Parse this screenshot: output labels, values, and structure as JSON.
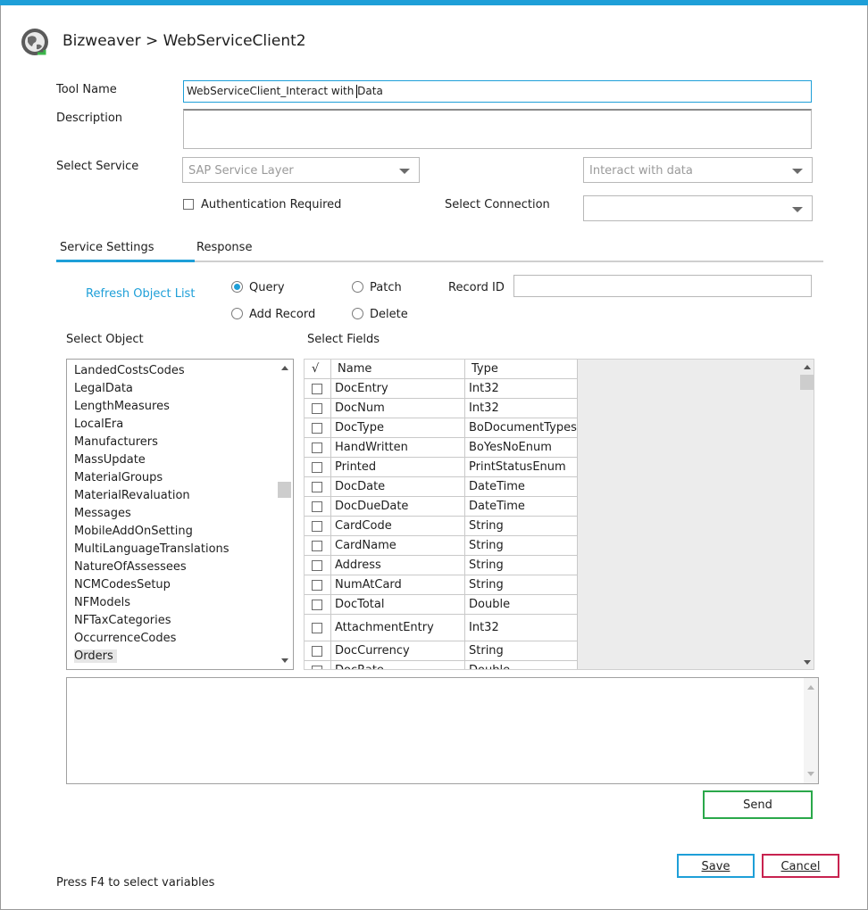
{
  "window": {
    "breadcrumb": "Bizweaver > WebServiceClient2"
  },
  "form": {
    "tool_name_label": "Tool Name",
    "tool_name_value": "WebServiceClient_Interact with Data",
    "description_label": "Description",
    "description_value": "",
    "select_service_label": "Select Service",
    "service_value": "SAP Service Layer",
    "action_value": "Interact with data",
    "auth_label": "Authentication Required",
    "select_connection_label": "Select Connection",
    "connection_value": ""
  },
  "tabs": [
    {
      "label": "Service Settings",
      "active": true
    },
    {
      "label": "Response",
      "active": false
    }
  ],
  "settings": {
    "refresh_label": "Refresh Object List",
    "radios": [
      {
        "label": "Query",
        "selected": true
      },
      {
        "label": "Patch",
        "selected": false
      },
      {
        "label": "Add Record",
        "selected": false
      },
      {
        "label": "Delete",
        "selected": false
      }
    ],
    "record_id_label": "Record ID",
    "record_id_value": ""
  },
  "objects": {
    "label": "Select Object",
    "items": [
      "LandedCostsCodes",
      "LegalData",
      "LengthMeasures",
      "LocalEra",
      "Manufacturers",
      "MassUpdate",
      "MaterialGroups",
      "MaterialRevaluation",
      "Messages",
      "MobileAddOnSetting",
      "MultiLanguageTranslations",
      "NatureOfAssessees",
      "NCMCodesSetup",
      "NFModels",
      "NFTaxCategories",
      "OccurrenceCodes",
      "Orders"
    ],
    "selected": "Orders"
  },
  "fields": {
    "label": "Select Fields",
    "check_header": "√",
    "name_header": "Name",
    "type_header": "Type",
    "rows": [
      {
        "name": "DocEntry",
        "type": "Int32"
      },
      {
        "name": "DocNum",
        "type": "Int32"
      },
      {
        "name": "DocType",
        "type": "BoDocumentTypes"
      },
      {
        "name": "HandWritten",
        "type": "BoYesNoEnum"
      },
      {
        "name": "Printed",
        "type": "PrintStatusEnum"
      },
      {
        "name": "DocDate",
        "type": "DateTime"
      },
      {
        "name": "DocDueDate",
        "type": "DateTime"
      },
      {
        "name": "CardCode",
        "type": "String"
      },
      {
        "name": "CardName",
        "type": "String"
      },
      {
        "name": "Address",
        "type": "String"
      },
      {
        "name": "NumAtCard",
        "type": "String"
      },
      {
        "name": "DocTotal",
        "type": "Double"
      },
      {
        "name": "AttachmentEntry",
        "type": "Int32"
      },
      {
        "name": "DocCurrency",
        "type": "String"
      },
      {
        "name": "DocRate",
        "type": "Double"
      }
    ]
  },
  "output_value": "",
  "buttons": {
    "send": "Send",
    "save": "Save",
    "cancel": "Cancel"
  },
  "colors": {
    "accent": "#1e9fd8",
    "send_border": "#2aa84a",
    "save_border": "#1e9fd8",
    "cancel_border": "#c8224f"
  },
  "footer": {
    "hint": "Press F4 to select variables"
  }
}
